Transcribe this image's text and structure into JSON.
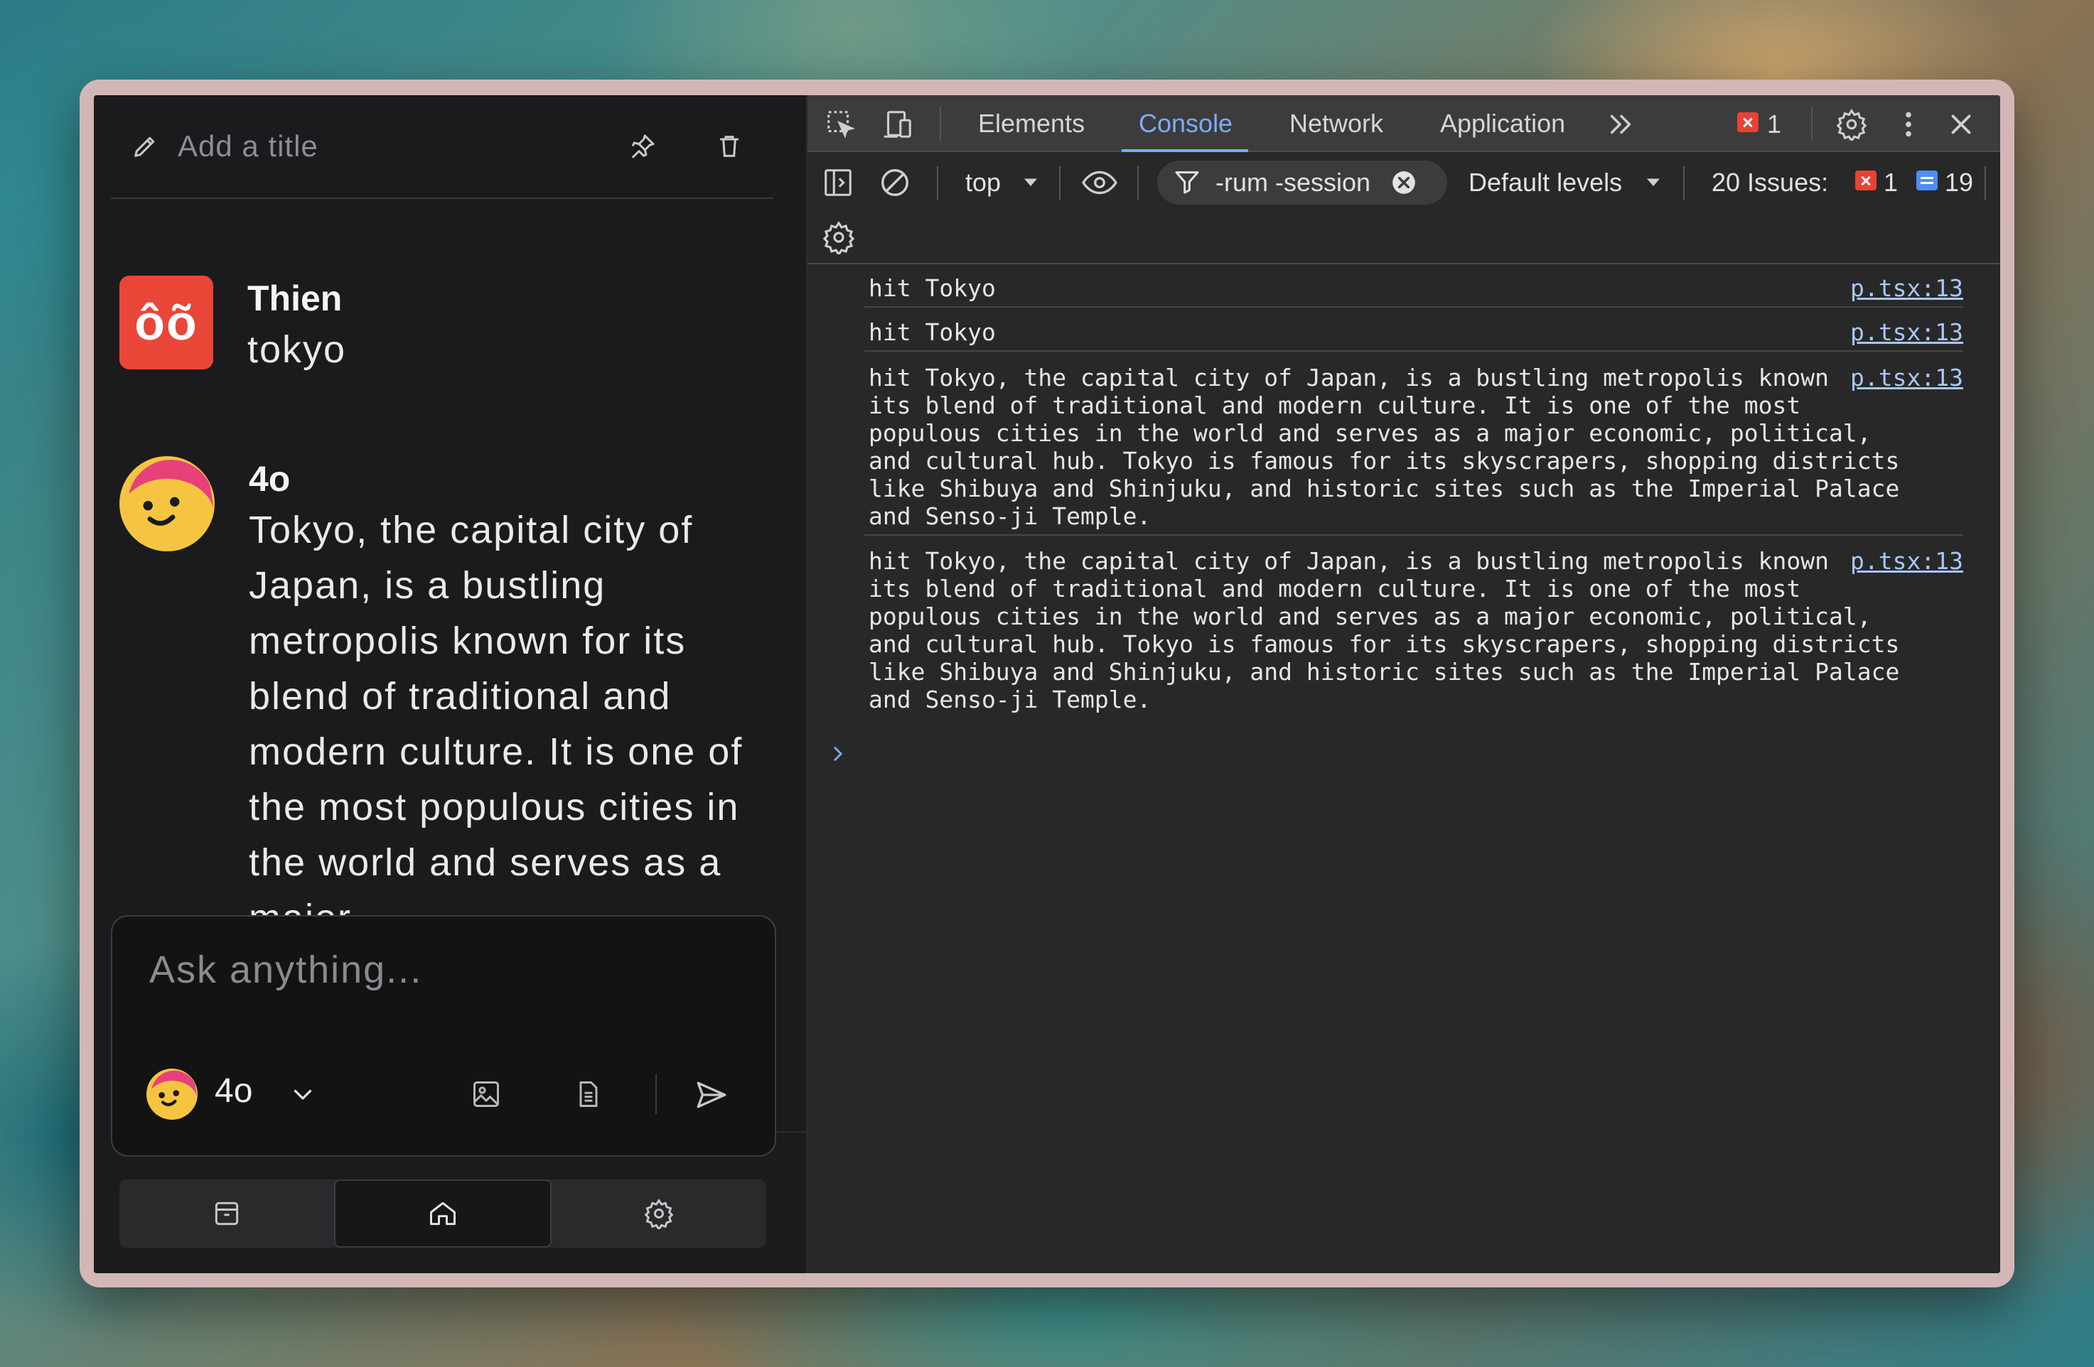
{
  "chat": {
    "title_placeholder": "Add a title",
    "user": {
      "avatar_text": "ôõ",
      "name": "Thien",
      "message": "tokyo"
    },
    "assistant": {
      "name": "4o",
      "message": "Tokyo, the capital city of Japan, is a bustling metropolis known for its blend of traditional and modern culture. It is one of the most populous cities in the world and serves as a major"
    },
    "composer": {
      "placeholder": "Ask anything...",
      "model": "4o"
    },
    "tabs": [
      {
        "icon": "archive-icon",
        "active": false
      },
      {
        "icon": "home-icon",
        "active": true
      },
      {
        "icon": "settings-icon",
        "active": false
      }
    ]
  },
  "devtools": {
    "tabs": [
      "Elements",
      "Console",
      "Network",
      "Application"
    ],
    "active_tab": "Console",
    "error_count": "1",
    "context": "top",
    "filter": "-rum -session",
    "levels": "Default levels",
    "issues_label": "20 Issues:",
    "issues_errors": "1",
    "issues_info": "19",
    "logs": [
      {
        "text": "hit Tokyo",
        "source": "p.tsx:13"
      },
      {
        "text": "hit Tokyo",
        "source": "p.tsx:13"
      },
      {
        "text": "hit Tokyo, the capital city of Japan, is a bustling metropolis known for its blend of traditional and modern culture. It is one of the most populous cities in the world and serves as a major economic, political, and cultural hub. Tokyo is famous for its skyscrapers, shopping districts like Shibuya and Shinjuku, and historic sites such as the Imperial Palace and Senso-ji Temple.",
        "source": "p.tsx:13"
      },
      {
        "text": "hit Tokyo, the capital city of Japan, is a bustling metropolis known for its blend of traditional and modern culture. It is one of the most populous cities in the world and serves as a major economic, political, and cultural hub. Tokyo is famous for its skyscrapers, shopping districts like Shibuya and Shinjuku, and historic sites such as the Imperial Palace and Senso-ji Temple.",
        "source": "p.tsx:13"
      }
    ]
  },
  "colors": {
    "accent": "#7cacf8",
    "error": "#e84235",
    "user_avatar": "#ea4637"
  }
}
